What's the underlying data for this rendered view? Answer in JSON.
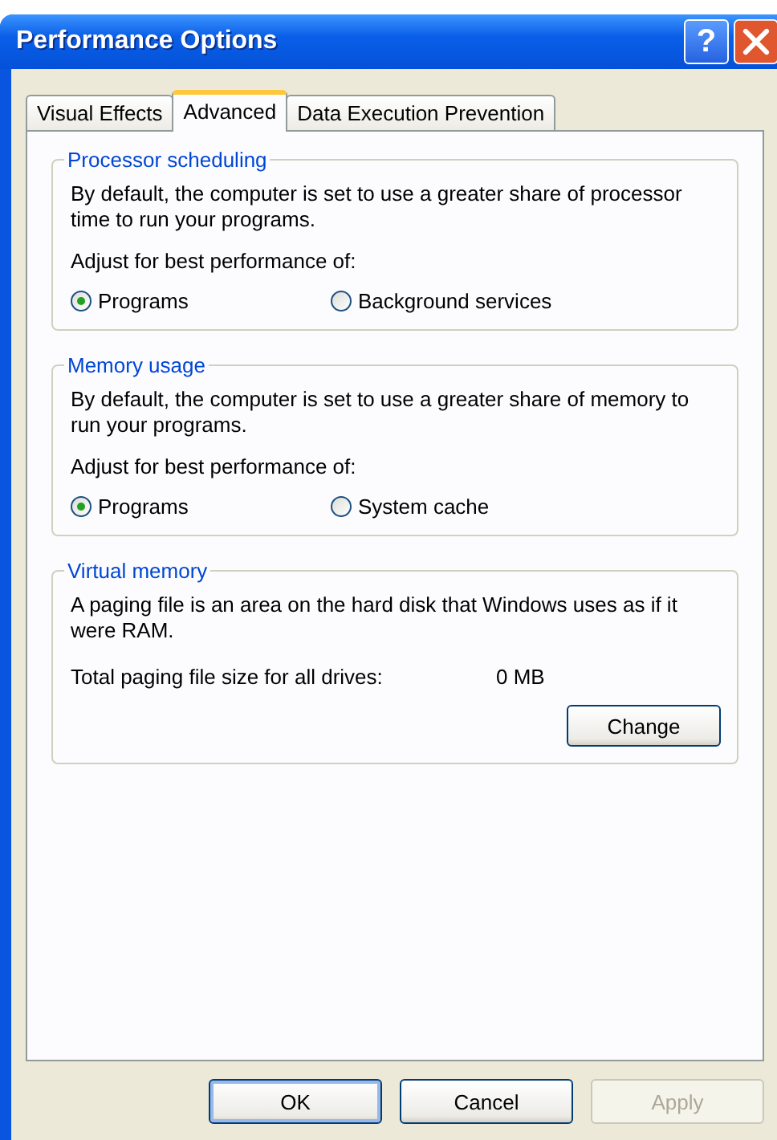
{
  "window": {
    "title": "Performance Options",
    "help_glyph": "?"
  },
  "tabs": [
    {
      "label": "Visual Effects",
      "selected": false
    },
    {
      "label": "Advanced",
      "selected": true
    },
    {
      "label": "Data Execution Prevention",
      "selected": false
    }
  ],
  "groups": [
    {
      "kind": "radio",
      "title": "Processor scheduling",
      "description": "By default, the computer is set to use a greater share of processor time to run your programs.",
      "prompt": "Adjust for best performance of:",
      "options": [
        {
          "label": "Programs",
          "selected": true
        },
        {
          "label": "Background services",
          "selected": false
        }
      ]
    },
    {
      "kind": "radio",
      "title": "Memory usage",
      "description": "By default, the computer is set to use a greater share of memory to run your programs.",
      "prompt": "Adjust for best performance of:",
      "options": [
        {
          "label": "Programs",
          "selected": true
        },
        {
          "label": "System cache",
          "selected": false
        }
      ]
    },
    {
      "kind": "paging",
      "title": "Virtual memory",
      "description": "A paging file is an area on the hard disk that Windows uses as if it were RAM.",
      "total_label": "Total paging file size for all drives:",
      "total_value": "0 MB",
      "button": "Change"
    }
  ],
  "buttons": [
    {
      "label": "OK",
      "default": true,
      "disabled": false
    },
    {
      "label": "Cancel",
      "default": false,
      "disabled": false
    },
    {
      "label": "Apply",
      "default": false,
      "disabled": true
    }
  ]
}
